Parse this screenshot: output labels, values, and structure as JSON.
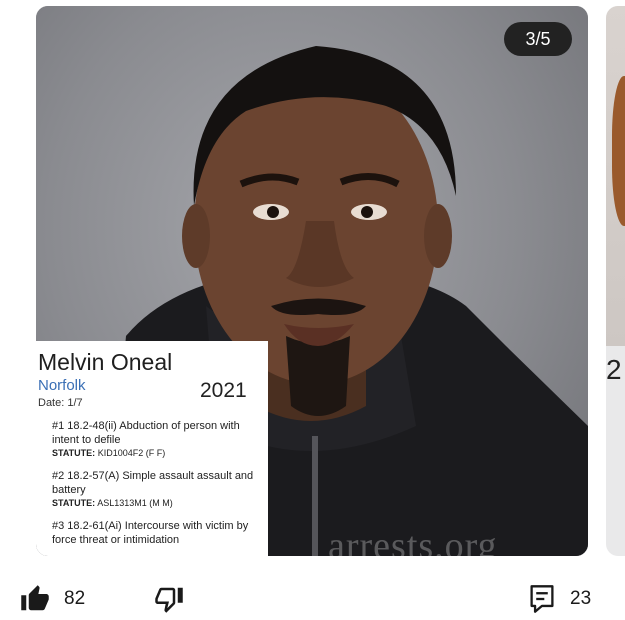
{
  "slide": {
    "counter": "3/5"
  },
  "record": {
    "name": "Melvin Oneal",
    "location": "Norfolk",
    "year": "2021",
    "date": "Date: 1/7",
    "charges": [
      {
        "description": "#1 18.2-48(ii) Abduction of person with intent to defile",
        "statute_label": "STATUTE:",
        "statute_code": "KID1004F2 (F F)"
      },
      {
        "description": "#2 18.2-57(A) Simple assault assault and battery",
        "statute_label": "STATUTE:",
        "statute_code": "ASL1313M1 (M M)"
      },
      {
        "description": "#3 18.2-61(Ai) Intercourse with victim by force threat or intimidation",
        "statute_label": "",
        "statute_code": ""
      }
    ]
  },
  "watermark": "arrests.org",
  "next_card": {
    "peek_text": "2"
  },
  "actions": {
    "like_count": "82",
    "comment_count": "23",
    "icons": {
      "like": "thumbs-up-icon",
      "dislike": "thumbs-down-icon",
      "comment": "comment-icon"
    }
  },
  "colors": {
    "location_link": "#3a6fb5",
    "counter_badge": "#222222"
  }
}
